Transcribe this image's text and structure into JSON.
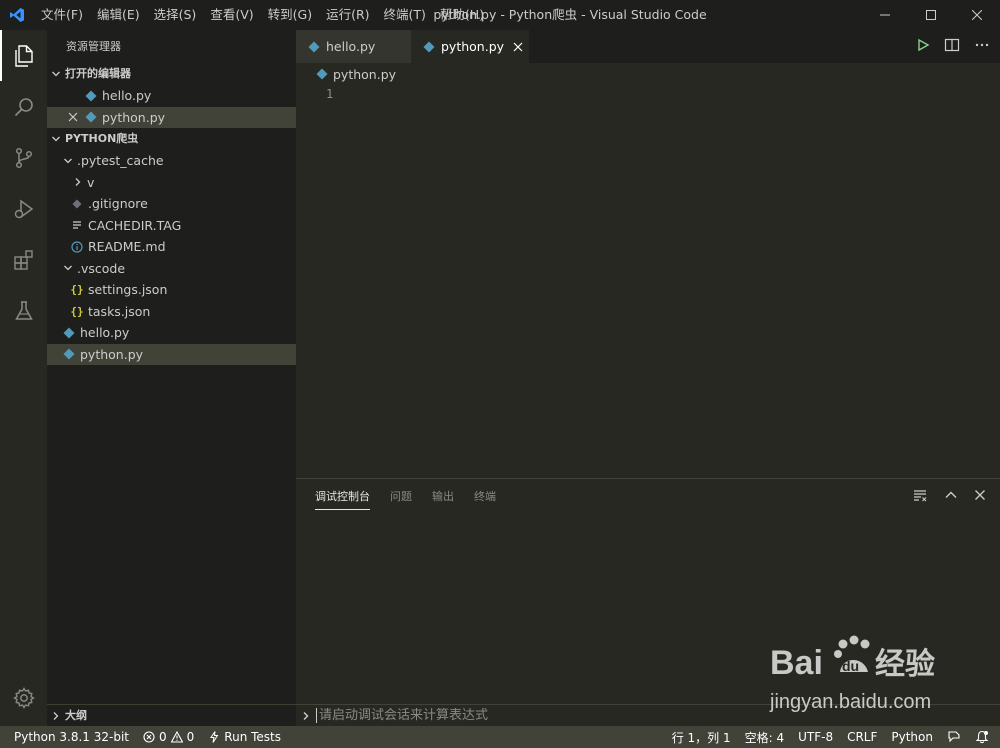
{
  "window": {
    "title": "python.py - Python爬虫 - Visual Studio Code"
  },
  "menu": [
    "文件(F)",
    "编辑(E)",
    "选择(S)",
    "查看(V)",
    "转到(G)",
    "运行(R)",
    "终端(T)",
    "帮助(H)"
  ],
  "activity_bar": [
    "explorer-icon",
    "search-icon",
    "source-control-icon",
    "run-debug-icon",
    "extensions-icon",
    "testing-icon"
  ],
  "sidebar": {
    "title": "资源管理器",
    "open_editors": {
      "header": "打开的编辑器",
      "items": [
        {
          "label": "hello.py",
          "icon": "python-icon"
        },
        {
          "label": "python.py",
          "icon": "python-icon"
        }
      ]
    },
    "folder": {
      "header": "PYTHON爬虫",
      "items": [
        {
          "label": ".pytest_cache",
          "type": "folder-open"
        },
        {
          "label": "v",
          "type": "folder-closed"
        },
        {
          "label": ".gitignore",
          "type": "file"
        },
        {
          "label": "CACHEDIR.TAG",
          "type": "file"
        },
        {
          "label": "README.md",
          "type": "file"
        },
        {
          "label": ".vscode",
          "type": "folder-open"
        },
        {
          "label": "settings.json",
          "type": "json"
        },
        {
          "label": "tasks.json",
          "type": "json"
        },
        {
          "label": "hello.py",
          "type": "python"
        },
        {
          "label": "python.py",
          "type": "python"
        }
      ]
    },
    "outline": "大纲"
  },
  "editor": {
    "tabs": [
      {
        "label": "hello.py",
        "active": false
      },
      {
        "label": "python.py",
        "active": true
      }
    ],
    "breadcrumb": "python.py",
    "line_number": "1"
  },
  "panel": {
    "tabs": [
      "调试控制台",
      "问题",
      "输出",
      "终端"
    ],
    "active_tab": "调试控制台",
    "repl_placeholder": "请启动调试会话来计算表达式"
  },
  "status_bar": {
    "interpreter": "Python 3.8.1 32-bit",
    "errors": "0",
    "warnings": "0",
    "run_tests": "Run Tests",
    "cursor": "行 1，列 1",
    "spaces": "空格: 4",
    "encoding": "UTF-8",
    "eol": "CRLF",
    "language": "Python"
  },
  "watermark": {
    "brand": "Bai",
    "brand2": "du",
    "jingyan": "经验",
    "url": "jingyan.baidu.com"
  },
  "colors": {
    "python_icon": "#519aba",
    "json_icon": "#cbcb41",
    "accent_vscode": "#3794ff",
    "run_green": "#89d185"
  }
}
